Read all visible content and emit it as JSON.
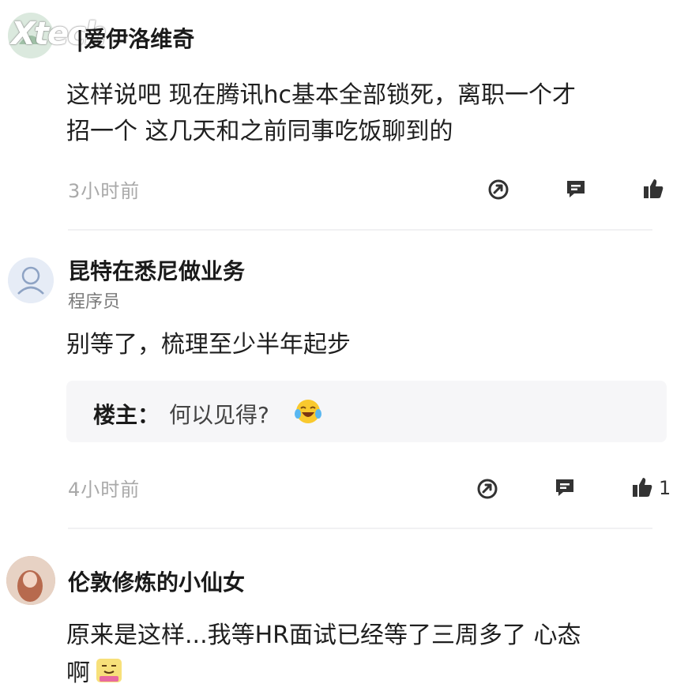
{
  "watermark": {
    "text": "Xtech"
  },
  "comments": [
    {
      "username": "|爱伊洛维奇",
      "text_lines": [
        "这样说吧 现在腾讯hc基本全部锁死，离职一个才",
        "招一个 这几天和之前同事吃饭聊到的"
      ],
      "time": "3小时前",
      "like_count": ""
    },
    {
      "username": "昆特在悉尼做业务",
      "role": "程序员",
      "text_lines": [
        "别等了，梳理至少半年起步"
      ],
      "reply": {
        "label": "楼主：",
        "text": "何以见得?"
      },
      "time": "4小时前",
      "like_count": "1"
    },
    {
      "username": "伦敦修炼的小仙女",
      "text_lines": [
        "原来是这样...我等HR面试已经等了三周多了 心态",
        "啊"
      ],
      "time": ""
    }
  ],
  "icons": {
    "share": "share-icon",
    "comment": "comment-icon",
    "like": "thumbs-up-icon",
    "emoji_laugh": "laugh-cry-emoji",
    "emoji_sticker": "sticker-emoji"
  }
}
